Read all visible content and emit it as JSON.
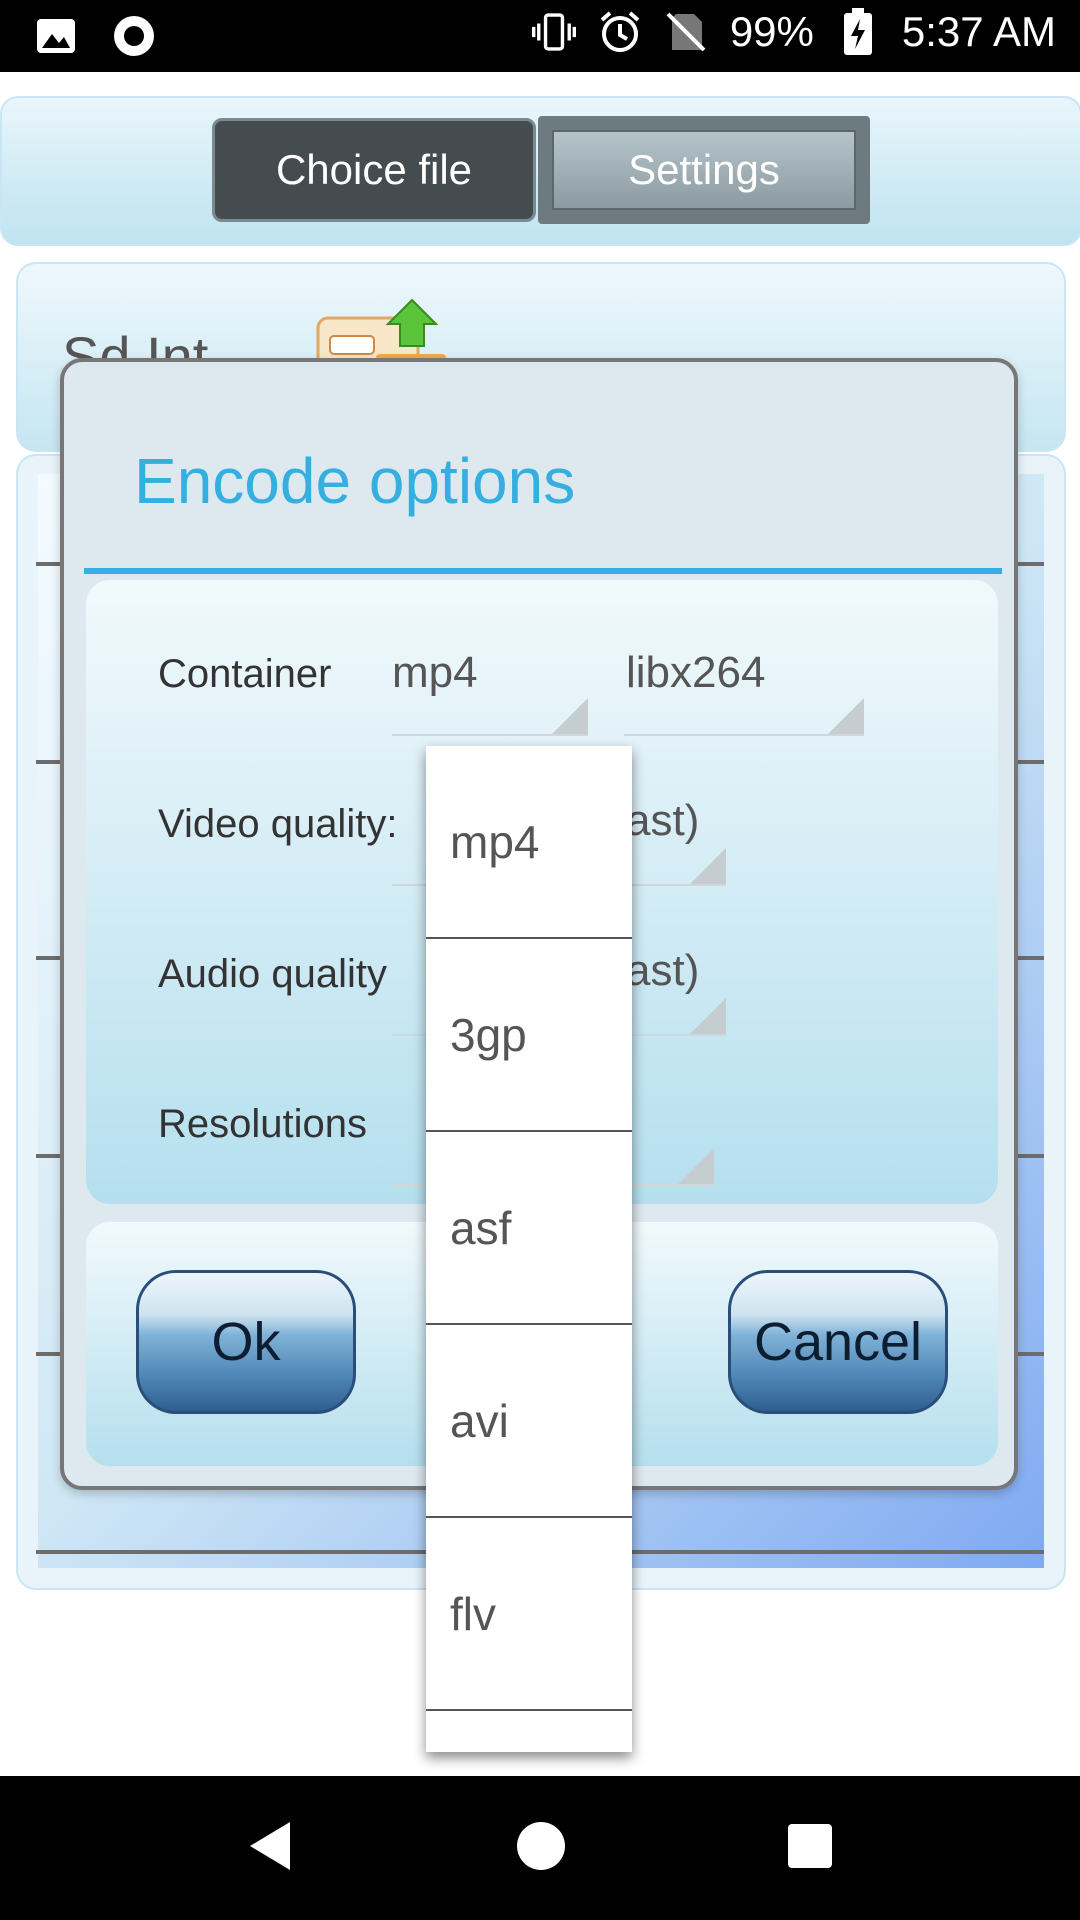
{
  "status_bar": {
    "battery": "99%",
    "time": "5:37 AM",
    "left_icons": [
      "image-icon",
      "record-icon"
    ],
    "right_icons": [
      "vibrate-icon",
      "alarm-icon",
      "no-sim-icon",
      "battery-charging-icon"
    ]
  },
  "header": {
    "choice_file_label": "Choice file",
    "settings_label": "Settings"
  },
  "background": {
    "storage_label": "Sd Int"
  },
  "dialog": {
    "title": "Encode options",
    "rows": [
      {
        "label": "Container",
        "value": "mp4",
        "value2": "libx264"
      },
      {
        "label": "Video quality:",
        "value": "ast)"
      },
      {
        "label": "Audio quality",
        "value": "ast)"
      },
      {
        "label": "Resolutions",
        "value": ""
      }
    ],
    "ok_label": "Ok",
    "cancel_label": "Cancel"
  },
  "dropdown": {
    "options": [
      "mp4",
      "3gp",
      "asf",
      "avi",
      "flv",
      ""
    ]
  },
  "colors": {
    "accent": "#35aee0",
    "status_bar": "#000000"
  }
}
